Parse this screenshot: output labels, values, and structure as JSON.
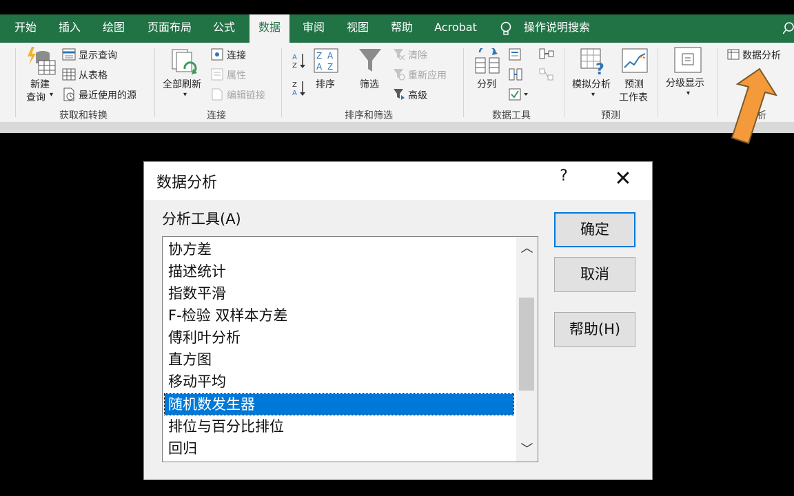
{
  "tabs": [
    {
      "label": "开始",
      "active": false
    },
    {
      "label": "插入",
      "active": false
    },
    {
      "label": "绘图",
      "active": false
    },
    {
      "label": "页面布局",
      "active": false
    },
    {
      "label": "公式",
      "active": false
    },
    {
      "label": "数据",
      "active": true
    },
    {
      "label": "审阅",
      "active": false
    },
    {
      "label": "视图",
      "active": false
    },
    {
      "label": "帮助",
      "active": false
    },
    {
      "label": "Acrobat",
      "active": false
    },
    {
      "label": "操作说明搜索",
      "active": false
    }
  ],
  "ribbon": {
    "get_transform": {
      "new_query_line1": "新建",
      "new_query_line2": "查询",
      "show_queries": "显示查询",
      "from_table": "从表格",
      "recent_sources": "最近使用的源",
      "group": "获取和转换"
    },
    "connections": {
      "refresh_all": "全部刷新",
      "connections": "连接",
      "properties": "属性",
      "edit_links": "编辑链接",
      "group": "连接"
    },
    "sort_filter": {
      "sort": "排序",
      "filter": "筛选",
      "clear": "清除",
      "reapply": "重新应用",
      "advanced": "高级",
      "group": "排序和筛选"
    },
    "data_tools": {
      "text_to_columns": "分列",
      "group": "数据工具"
    },
    "forecast": {
      "what_if": "模拟分析",
      "forecast_sheet_line1": "预测",
      "forecast_sheet_line2": "工作表",
      "group": "预测"
    },
    "outline": {
      "outline": "分级显示"
    },
    "analysis": {
      "data_analysis": "数据分析",
      "group_partial": "析"
    }
  },
  "dialog": {
    "title": "数据分析",
    "help_glyph": "?",
    "close_glyph": "✕",
    "tools_label": "分析工具(A)",
    "items": [
      "协方差",
      "描述统计",
      "指数平滑",
      "F-检验 双样本方差",
      "傅利叶分析",
      "直方图",
      "移动平均",
      "随机数发生器",
      "排位与百分比排位",
      "回归"
    ],
    "selected_index": 7,
    "ok": "确定",
    "cancel": "取消",
    "help_button": "帮助(H)"
  },
  "colors": {
    "excel_green": "#217346",
    "selection_blue": "#0078d7",
    "arrow_orange": "#f59a3a"
  }
}
